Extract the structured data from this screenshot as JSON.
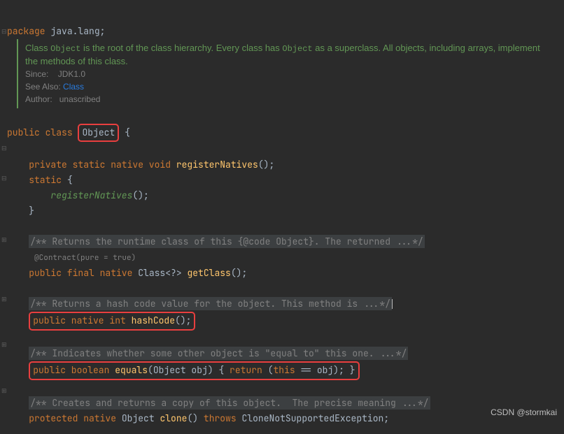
{
  "package": {
    "keyword": "package",
    "name": "java.lang"
  },
  "doc": {
    "sentence_pre": "Class ",
    "sentence_obj": "Object",
    "sentence_mid": " is the root of the class hierarchy. Every class has ",
    "sentence_obj2": "Object",
    "sentence_post": " as a superclass. All objects, including arrays, implement the methods of this class.",
    "since_label": "Since:",
    "since_val": "JDK1.0",
    "see_label": "See Also:",
    "see_val": "Class",
    "author_label": "Author:",
    "author_val": "unascribed"
  },
  "class": {
    "public": "public",
    "class_kw": "class",
    "name": "Object",
    "open": "{"
  },
  "registerNatives": {
    "mods": "private static native void",
    "name": "registerNatives",
    "parens": "();"
  },
  "staticBlock": {
    "static_kw": "static",
    "open": "{",
    "call": "registerNatives",
    "callParens": "();",
    "close": "}"
  },
  "getClassDoc": "/** Returns the runtime class of this {@code Object}. The returned ...*/",
  "contract": "@Contract(pure = true)",
  "getClass": {
    "mods": "public final native",
    "ret": "Class<?>",
    "name": "getClass",
    "parens": "();"
  },
  "hashDoc": "/** Returns a hash code value for the object. This method is ...*/",
  "hash": {
    "mods": "public native int",
    "name": "hashCode",
    "parens": "();"
  },
  "equalsDoc": "/** Indicates whether some other object is \"equal to\" this one. ...*/",
  "equals": {
    "mods": "public boolean",
    "name": "equals",
    "sig": "(Object obj)",
    "body_open": " { ",
    "ret": "return",
    "expr_open": " (",
    "this_kw": "this",
    "op": " == obj); ",
    "close": "}"
  },
  "cloneDoc": "/** Creates and returns a copy of this object.  The precise meaning ...*/",
  "clone": {
    "mods": "protected native",
    "ret": "Object",
    "name": "clone",
    "parens": "()",
    "throws_kw": "throws",
    "exc": "CloneNotSupportedException",
    "semi": ";"
  },
  "watermark": "CSDN @stormkai"
}
